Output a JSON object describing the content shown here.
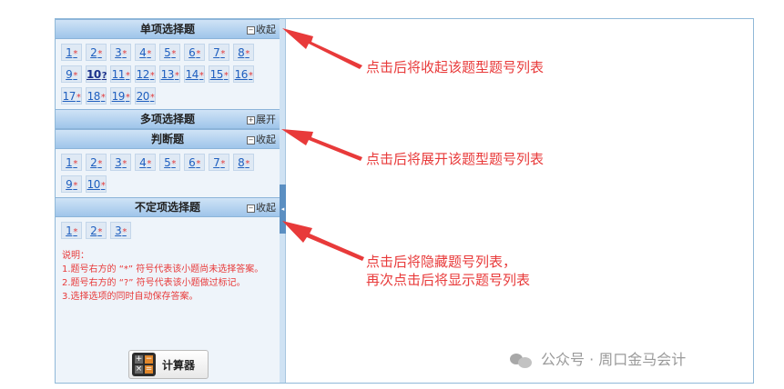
{
  "sections": [
    {
      "title": "单项选择题",
      "toggle_label": "收起",
      "toggle_symbol": "⊟",
      "questions": [
        {
          "num": "1",
          "mark": "*"
        },
        {
          "num": "2",
          "mark": "*"
        },
        {
          "num": "3",
          "mark": "*"
        },
        {
          "num": "4",
          "mark": "*"
        },
        {
          "num": "5",
          "mark": "*"
        },
        {
          "num": "6",
          "mark": "*"
        },
        {
          "num": "7",
          "mark": "*"
        },
        {
          "num": "8",
          "mark": "*"
        },
        {
          "num": "9",
          "mark": "*"
        },
        {
          "num": "10",
          "mark": "?"
        },
        {
          "num": "11",
          "mark": "*"
        },
        {
          "num": "12",
          "mark": "*"
        },
        {
          "num": "13",
          "mark": "*"
        },
        {
          "num": "14",
          "mark": "*"
        },
        {
          "num": "15",
          "mark": "*"
        },
        {
          "num": "16",
          "mark": "*"
        },
        {
          "num": "17",
          "mark": "*"
        },
        {
          "num": "18",
          "mark": "*"
        },
        {
          "num": "19",
          "mark": "*"
        },
        {
          "num": "20",
          "mark": "*"
        }
      ]
    },
    {
      "title": "多项选择题",
      "toggle_label": "展开",
      "toggle_symbol": "⊞",
      "questions": []
    },
    {
      "title": "判断题",
      "toggle_label": "收起",
      "toggle_symbol": "⊟",
      "questions": [
        {
          "num": "1",
          "mark": "*"
        },
        {
          "num": "2",
          "mark": "*"
        },
        {
          "num": "3",
          "mark": "*"
        },
        {
          "num": "4",
          "mark": "*"
        },
        {
          "num": "5",
          "mark": "*"
        },
        {
          "num": "6",
          "mark": "*"
        },
        {
          "num": "7",
          "mark": "*"
        },
        {
          "num": "8",
          "mark": "*"
        },
        {
          "num": "9",
          "mark": "*"
        },
        {
          "num": "10",
          "mark": "*"
        }
      ]
    },
    {
      "title": "不定项选择题",
      "toggle_label": "收起",
      "toggle_symbol": "⊟",
      "questions": [
        {
          "num": "1",
          "mark": "*"
        },
        {
          "num": "2",
          "mark": "*"
        },
        {
          "num": "3",
          "mark": "*"
        }
      ]
    }
  ],
  "notes": {
    "heading": "说明：",
    "line1": "1.题号右方的 “*” 符号代表该小题尚未选择答案。",
    "line2": "2.题号右方的 “?” 符号代表该小题做过标记。",
    "line3": "3.选择选项的同时自动保存答案。"
  },
  "calculator": {
    "label": "计算器",
    "icon": "calculator-icon",
    "keys": [
      "+",
      "−",
      "×",
      "="
    ]
  },
  "annotations": {
    "collapse": "点击后将收起该题型题号列表",
    "expand": "点击后将展开该题型题号列表",
    "hide_line1": "点击后将隐藏题号列表，",
    "hide_line2": "再次点击后将显示题号列表"
  },
  "watermark": {
    "text": "公众号 · 周口金马会计",
    "icon": "wechat-icon"
  },
  "colors": {
    "annotation_red": "#e83a3a",
    "link_blue": "#1f5fbf",
    "header_blue": "#9fc5ea"
  }
}
